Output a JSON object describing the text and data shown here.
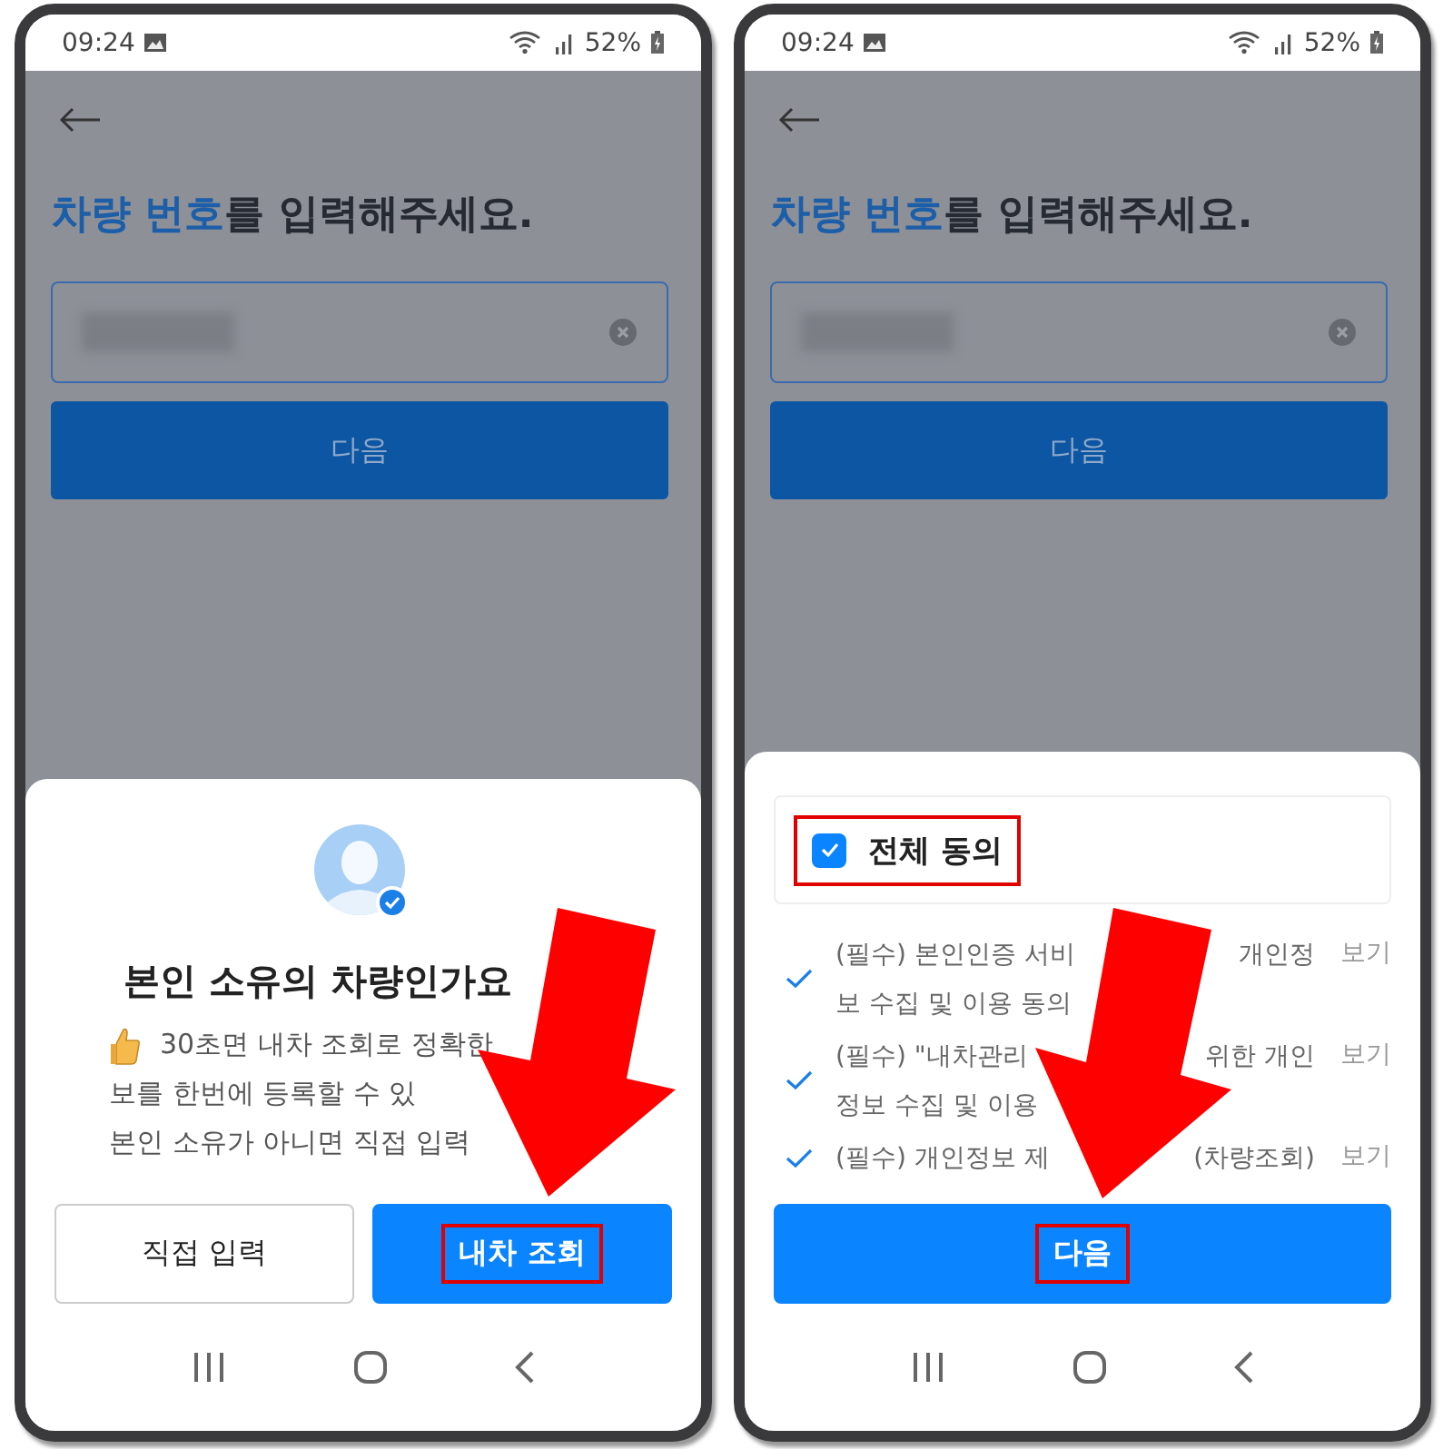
{
  "phones": [
    {
      "status_bar": {
        "time": "09:24",
        "battery": "52%"
      },
      "page": {
        "headline": [
          {
            "text": "차량 번호",
            "highlight": true
          },
          {
            "text": "를 입력해주세요.",
            "highlight": false
          }
        ],
        "button": "다음"
      },
      "sheet": {
        "kind": "ownership",
        "title": "본인 소유의 차량인가요",
        "lines": [
          "30초면 내차 조회로 정확한",
          "보를 한번에 등록할 수 있",
          "본인 소유가 아니면 직접 입력"
        ],
        "buttons": [
          {
            "label": "직접 입력",
            "primary": false,
            "highlighted": false
          },
          {
            "label": "내차 조회",
            "primary": true,
            "highlighted": true
          }
        ]
      }
    },
    {
      "status_bar": {
        "time": "09:24",
        "battery": "52%"
      },
      "page": {
        "headline": [
          {
            "text": "차량 번호",
            "highlight": true
          },
          {
            "text": "를 입력해주세요.",
            "highlight": false
          }
        ],
        "button": "다음"
      },
      "sheet": {
        "kind": "consent",
        "all": {
          "label": "전체 동의",
          "checked": true,
          "highlighted": true
        },
        "items": [
          {
            "checked": true,
            "lines": [
              [
                "(필수) 본인인증 서비",
                "개인정"
              ],
              [
                "보 수집 및 이용 동의"
              ]
            ],
            "link": "보기"
          },
          {
            "checked": true,
            "lines": [
              [
                "(필수) \"내차관리",
                "위한 개인"
              ],
              [
                "정보 수집 및 이용"
              ]
            ],
            "link": "보기"
          },
          {
            "checked": true,
            "lines": [
              [
                "(필수) 개인정보 제",
                "(차량조회)"
              ]
            ],
            "link": "보기"
          }
        ],
        "button": {
          "label": "다음",
          "highlighted": true
        }
      }
    }
  ]
}
